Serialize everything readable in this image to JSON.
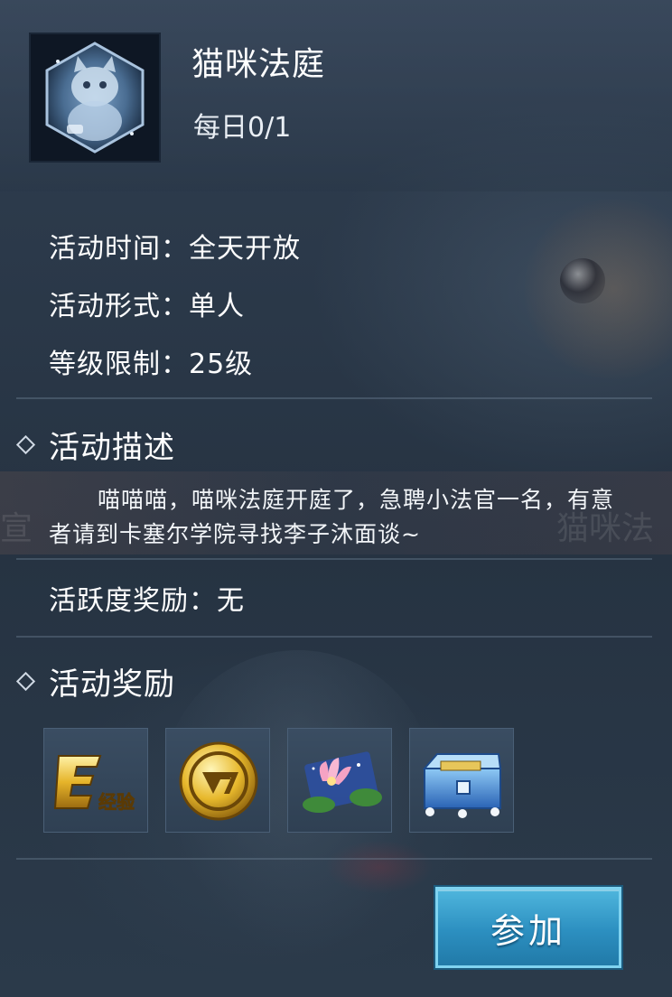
{
  "activity": {
    "title": "猫咪法庭",
    "daily_progress": "每日0/1",
    "icon": "cat-judge-emblem-icon"
  },
  "info": {
    "time_label": "活动时间：",
    "time_value": "全天开放",
    "form_label": "活动形式：",
    "form_value": "单人",
    "level_label": "等级限制：",
    "level_value": "25级"
  },
  "description": {
    "title": "活动描述",
    "text": "喵喵喵，喵咪法庭开庭了，急聘小法官一名，有意者请到卡塞尔学院寻找李子沐面谈~"
  },
  "activity_reward": {
    "label": "活跃度奖励：",
    "value": "无"
  },
  "rewards": {
    "title": "活动奖励",
    "items": [
      {
        "icon": "exp-icon",
        "label": "经验"
      },
      {
        "icon": "gold-coin-icon"
      },
      {
        "icon": "lotus-icon"
      },
      {
        "icon": "treasure-chest-icon"
      }
    ]
  },
  "background_text": {
    "left": "宣",
    "right": "猫咪法"
  },
  "join_button": {
    "label": "参加"
  },
  "colors": {
    "panel_bg": "#2a3746",
    "button_blue": "#2c8fc0",
    "divider": "#4a5f76"
  }
}
